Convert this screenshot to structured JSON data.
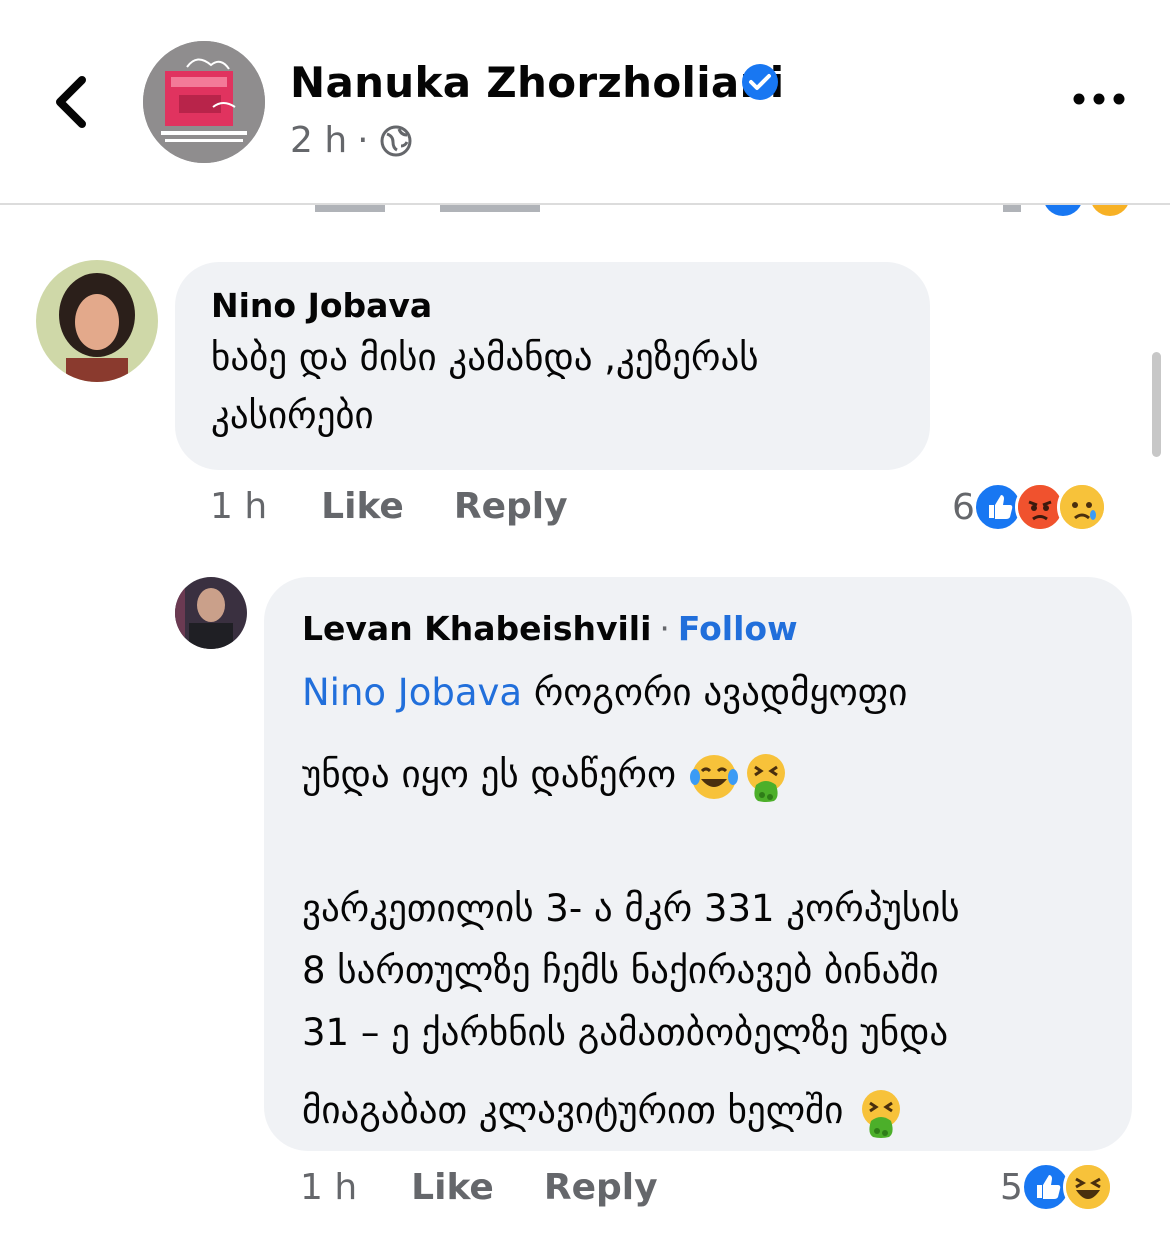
{
  "post_header": {
    "page_name": "Nanuka Zhorzholiani",
    "time": "2 h",
    "dot": "·"
  },
  "comments": [
    {
      "author": "Nino Jobava",
      "text_line1": "ხაბე და მისი კამანდა ,კეზერას",
      "text_line2": "კასირები",
      "time": "1 h",
      "like": "Like",
      "reply": "Reply",
      "reaction_count": "6",
      "reactions": [
        "like-icon",
        "angry-icon",
        "sad-icon"
      ]
    }
  ],
  "reply": {
    "author": "Levan Khabeishvili",
    "separator": "·",
    "follow": "Follow",
    "mention": "Nino Jobava",
    "line1_rest": " როგორი ავადმყოფი",
    "line2": "უნდა იყო ეს დაწერო",
    "line3": "ვარკეთილის 3- ა მკრ 331 კორპუსის",
    "line4": "8 სართულზე ჩემს ნაქირავებ ბინაში",
    "line5": "31 – ე ქარხნის გამათბობელზე უნდა",
    "line6": "მიაგაბათ კლავიტურით ხელში",
    "time": "1 h",
    "like": "Like",
    "reply": "Reply",
    "reaction_count": "5",
    "reactions": [
      "like-icon",
      "haha-icon"
    ]
  },
  "colors": {
    "accent": "#216fdb",
    "secondary_text": "#65676b",
    "bubble": "#f0f2f5"
  }
}
